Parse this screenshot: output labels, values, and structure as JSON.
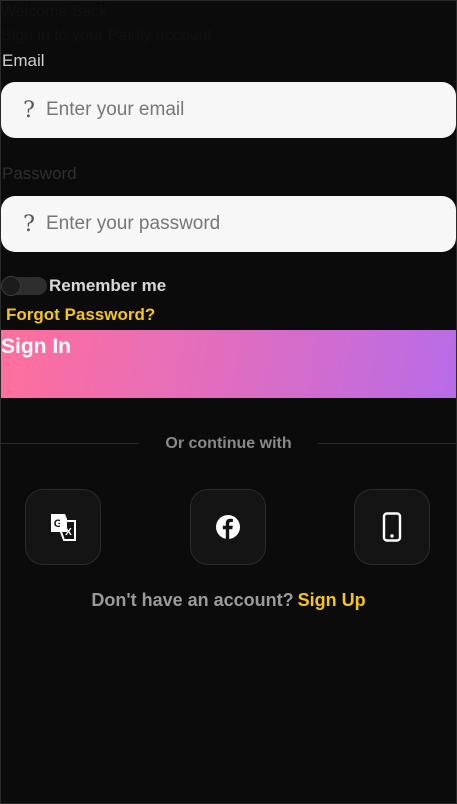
{
  "header": {
    "welcome": "Welcome Back",
    "subtitle": "Sign in to your Pairily account"
  },
  "form": {
    "email_label": "Email",
    "email_placeholder": "Enter your email",
    "email_icon": "?",
    "password_label": "Password",
    "password_placeholder": "Enter your password",
    "password_icon": "?",
    "remember_label": "Remember me",
    "remember_checked": false,
    "forgot_label": "Forgot Password?",
    "signin_label": "Sign In"
  },
  "social": {
    "divider_text": "Or continue with",
    "buttons": [
      {
        "icon": "google-translate-icon"
      },
      {
        "icon": "facebook-icon"
      },
      {
        "icon": "phone-icon"
      }
    ]
  },
  "footer": {
    "question": "Don't have an account?",
    "signup_label": "Sign Up"
  },
  "colors": {
    "background": "#0b0b0b",
    "accent": "#f5c518",
    "gradient_start": "#ff6f9c",
    "gradient_end": "#b76be8",
    "field_bg": "#f7f7f7"
  }
}
